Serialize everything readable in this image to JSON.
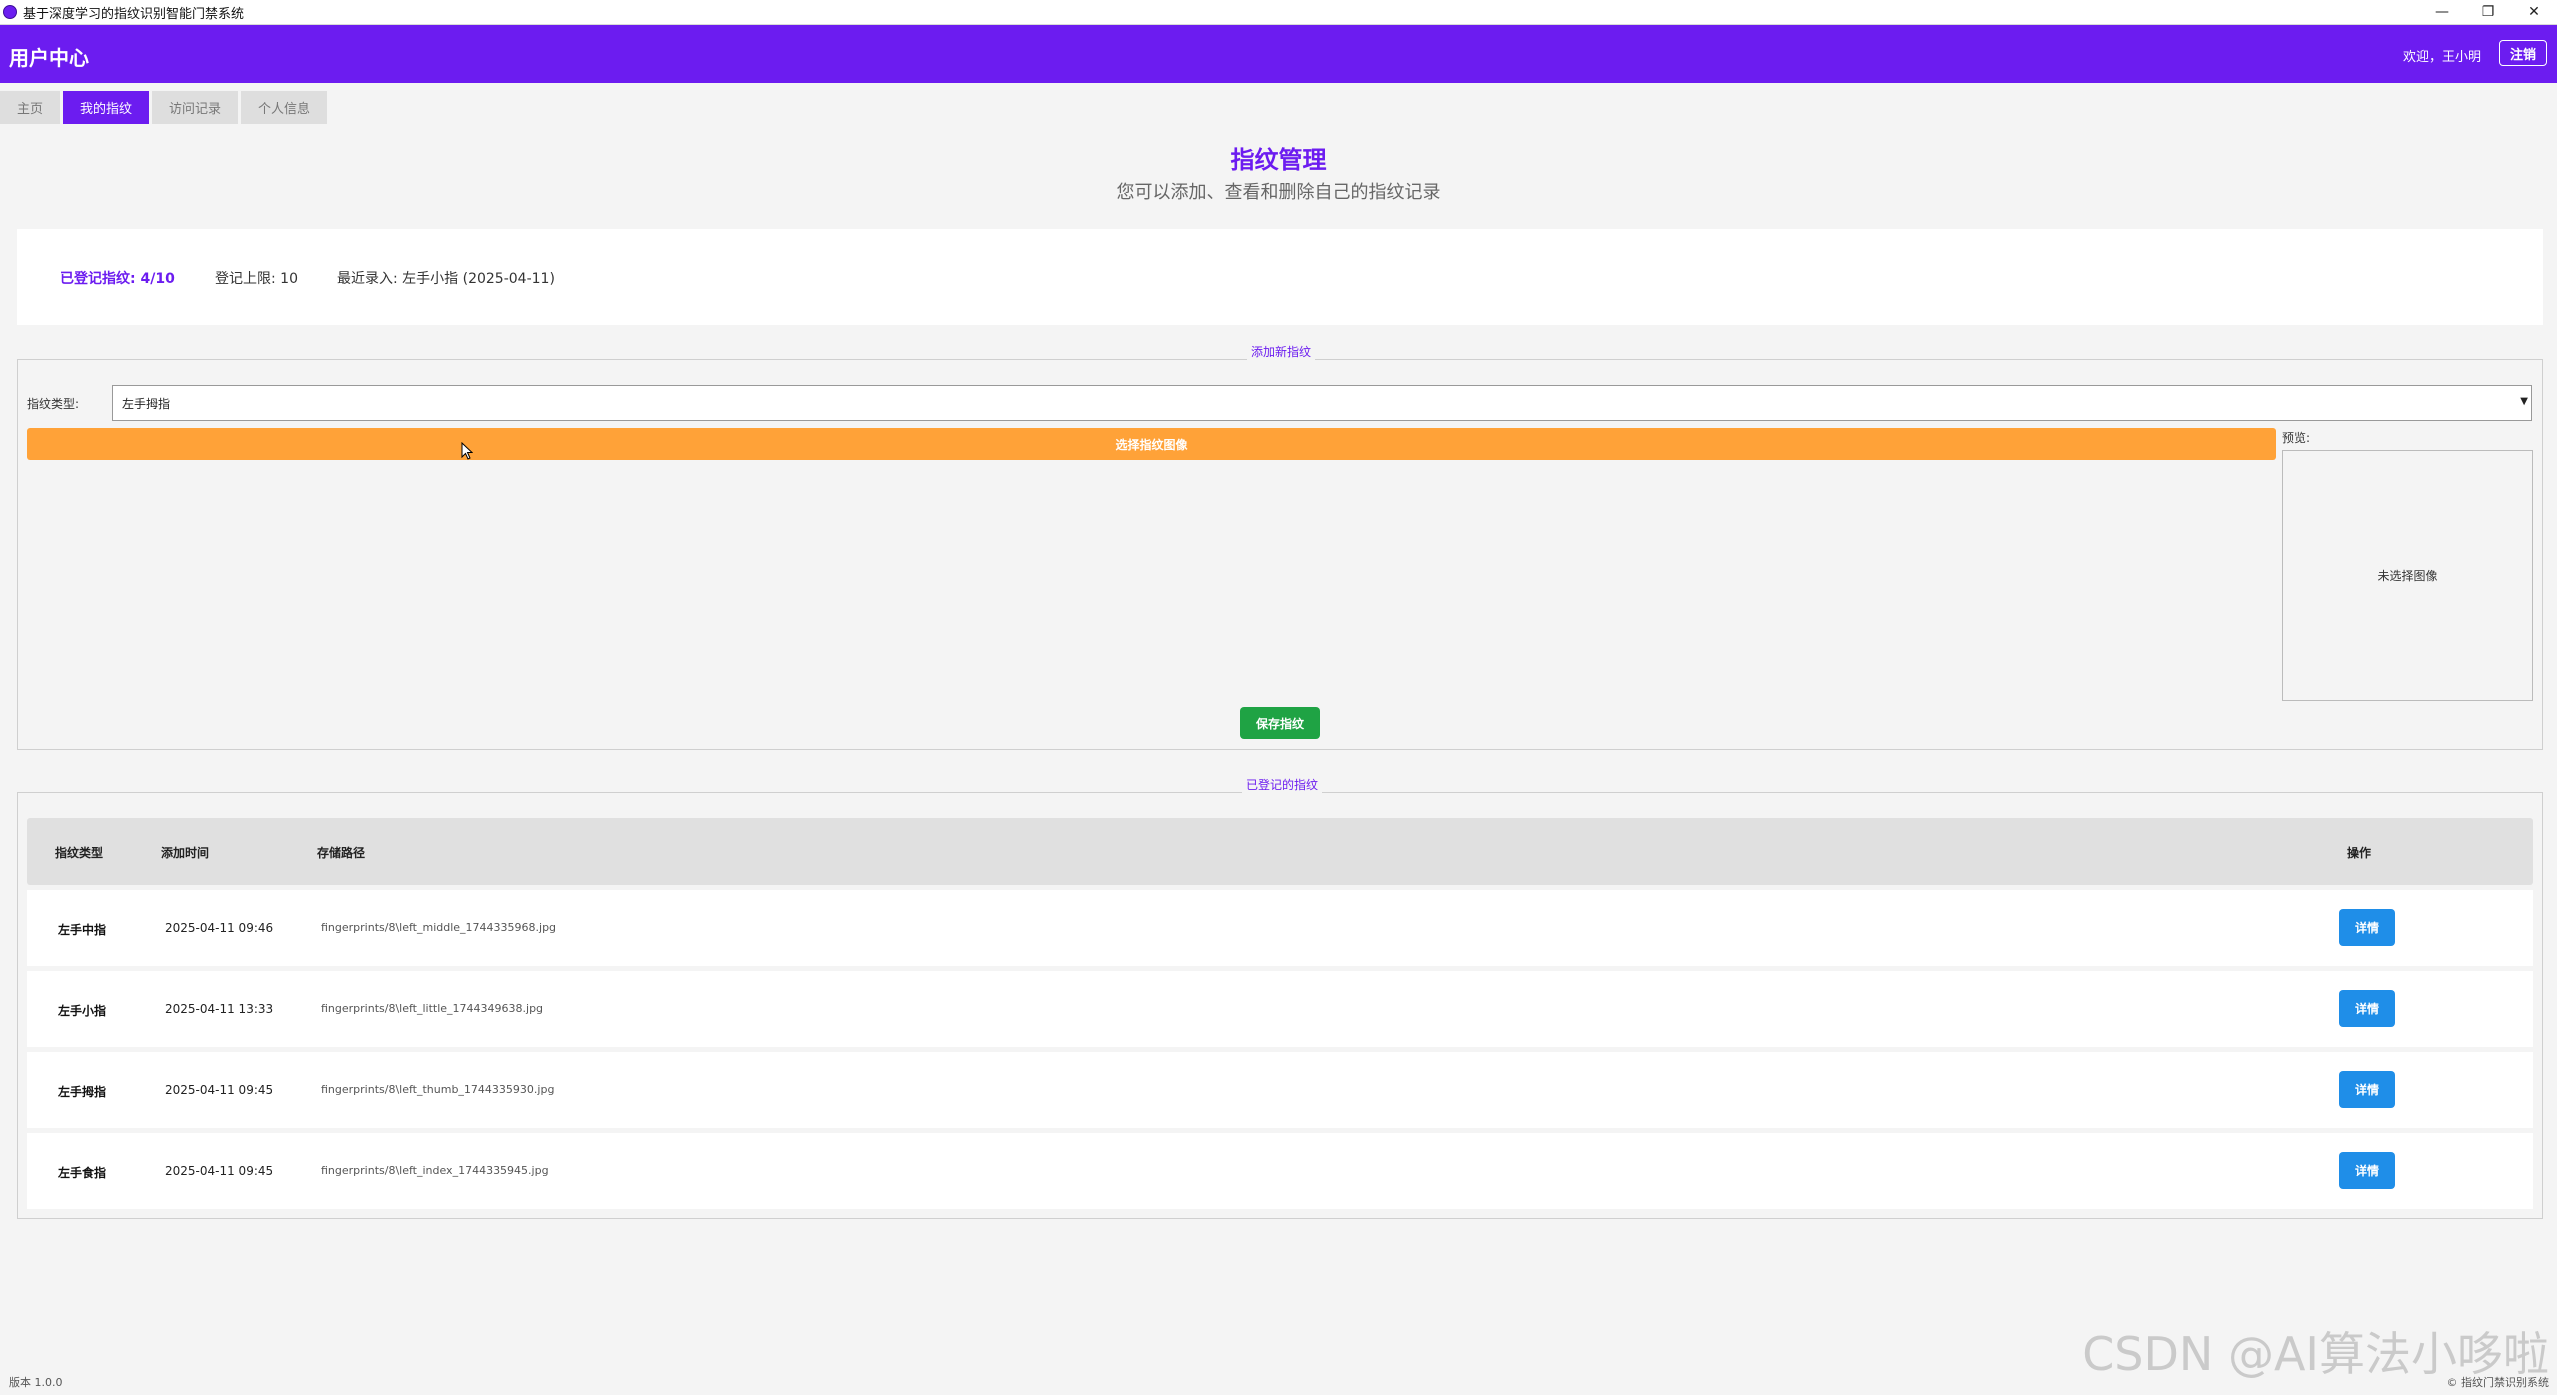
{
  "window": {
    "title": "基于深度学习的指纹识别智能门禁系统",
    "controls": {
      "minimize": "—",
      "maximize": "❐",
      "close": "✕"
    }
  },
  "header": {
    "title": "用户中心",
    "welcome": "欢迎，王小明",
    "logout_label": "注销",
    "accent_color": "#6c1cf0"
  },
  "tabs": [
    {
      "label": "主页",
      "active": false
    },
    {
      "label": "我的指纹",
      "active": true
    },
    {
      "label": "访问记录",
      "active": false
    },
    {
      "label": "个人信息",
      "active": false
    }
  ],
  "page": {
    "title": "指纹管理",
    "subtitle": "您可以添加、查看和删除自己的指纹记录"
  },
  "stats": {
    "registered": "已登记指纹: 4/10",
    "limit": "登记上限: 10",
    "recent": "最近录入: 左手小指 (2025-04-11)"
  },
  "add_section": {
    "label": "添加新指纹",
    "type_label": "指纹类型:",
    "type_value": "左手拇指",
    "choose_button": "选择指纹图像",
    "preview_label": "预览:",
    "preview_placeholder": "未选择图像",
    "save_button": "保存指纹"
  },
  "list_section": {
    "label": "已登记的指纹",
    "columns": [
      "指纹类型",
      "添加时间",
      "存储路径",
      "操作"
    ],
    "rows": [
      {
        "type": "左手中指",
        "time": "2025-04-11 09:46",
        "path": "fingerprints/8\\left_middle_1744335968.jpg",
        "action": "详情"
      },
      {
        "type": "左手小指",
        "time": "2025-04-11 13:33",
        "path": "fingerprints/8\\left_little_1744349638.jpg",
        "action": "详情"
      },
      {
        "type": "左手拇指",
        "time": "2025-04-11 09:45",
        "path": "fingerprints/8\\left_thumb_1744335930.jpg",
        "action": "详情"
      },
      {
        "type": "左手食指",
        "time": "2025-04-11 09:45",
        "path": "fingerprints/8\\left_index_1744335945.jpg",
        "action": "详情"
      }
    ]
  },
  "footer": {
    "version": "版本 1.0.0",
    "copyright": "© 指纹门禁识别系统"
  },
  "watermark": "CSDN @AI算法小哆啦",
  "colors": {
    "orange": "#ffa238",
    "green": "#1fa344",
    "blue": "#1f8ee8"
  }
}
